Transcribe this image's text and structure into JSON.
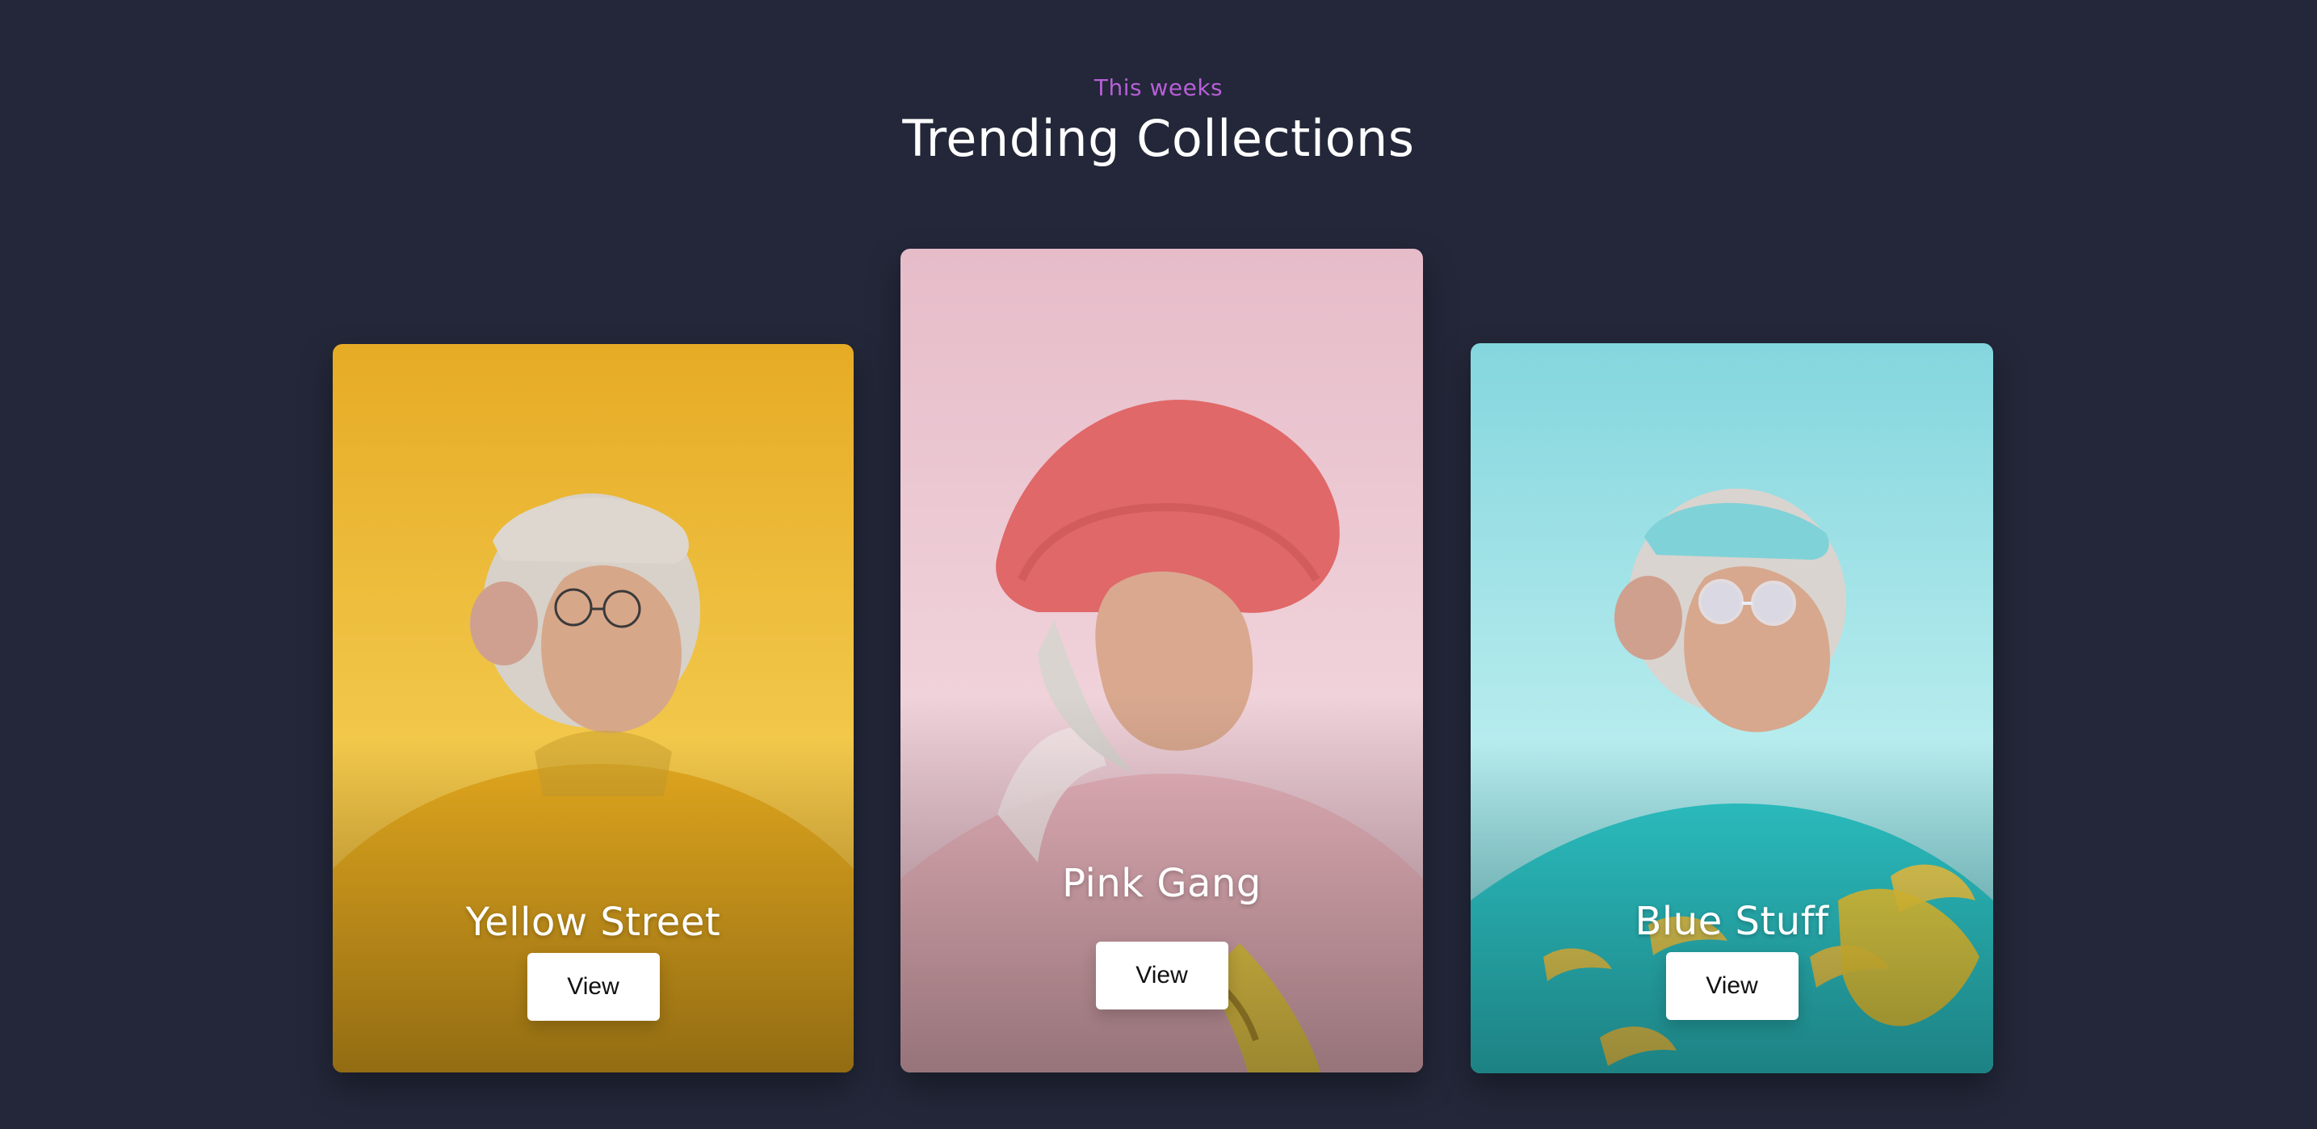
{
  "header": {
    "eyebrow": "This weeks",
    "title": "Trending Collections"
  },
  "cards": [
    {
      "name": "Yellow Street",
      "button_label": "View",
      "colors": {
        "top": "#e3a927",
        "mid": "#f2c84a",
        "bottom": "#d3a22c",
        "accent": "#f2c84a"
      },
      "art": "ape-yellow-cap-glasses-jacket"
    },
    {
      "name": "Pink Gang",
      "button_label": "View",
      "colors": {
        "top": "#e6bcc8",
        "mid": "#f0d2da",
        "bottom": "#d5a5b2",
        "accent": "#e86a6a"
      },
      "art": "ape-pink-bucket-hat-banana"
    },
    {
      "name": "Blue Stuff",
      "button_label": "View",
      "colors": {
        "top": "#86d7de",
        "mid": "#b8ecee",
        "bottom": "#5bc3c8",
        "accent": "#2ec9c9"
      },
      "art": "ape-blue-banana-shirt-glasses"
    }
  ]
}
